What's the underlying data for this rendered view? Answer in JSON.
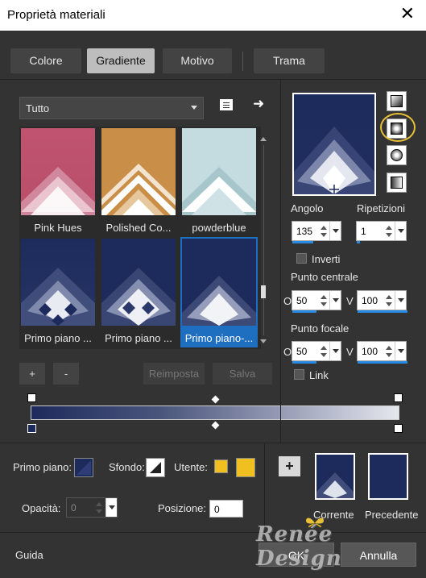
{
  "window": {
    "title": "Proprietà materiali",
    "close": "✕"
  },
  "tabs": [
    {
      "label": "Colore",
      "active": false
    },
    {
      "label": "Gradiente",
      "active": true
    },
    {
      "label": "Motivo",
      "active": false
    },
    {
      "label": "Trama",
      "active": false
    }
  ],
  "category": {
    "selected": "Tutto"
  },
  "swatches": [
    {
      "label": "Pink Hues",
      "selected": false
    },
    {
      "label": "Polished Co...",
      "selected": false
    },
    {
      "label": "powderblue",
      "selected": false
    },
    {
      "label": "Primo piano ...",
      "selected": false
    },
    {
      "label": "Primo piano ...",
      "selected": false
    },
    {
      "label": "Primo piano-...",
      "selected": true
    }
  ],
  "list_buttons": {
    "add": "+",
    "remove": "-",
    "reset": "Reimposta",
    "save": "Salva"
  },
  "gradient_settings": {
    "angle_label": "Angolo",
    "angle": "135",
    "repeats_label": "Ripetizioni",
    "repeats": "1",
    "invert_label": "Inverti",
    "center_label": "Punto centrale",
    "center_h_label": "O",
    "center_h": "50",
    "center_v_label": "V",
    "center_v": "100",
    "focal_label": "Punto focale",
    "focal_h_label": "O",
    "focal_h": "50",
    "focal_v_label": "V",
    "focal_v": "100",
    "link_label": "Link"
  },
  "colors": {
    "navy": "#1d2b5c",
    "accent_blue": "#2a8ae0",
    "user_yellow": "#f0c020",
    "highlight": "#e8c036"
  },
  "footer": {
    "foreground_label": "Primo piano:",
    "background_label": "Sfondo:",
    "user_label": "Utente:",
    "opacity_label": "Opacità:",
    "opacity": "0",
    "position_label": "Posizione:",
    "position": "0",
    "add_button": "+",
    "current_label": "Corrente",
    "previous_label": "Precedente",
    "help": "Guida",
    "ok": "OK",
    "cancel": "Annulla"
  }
}
